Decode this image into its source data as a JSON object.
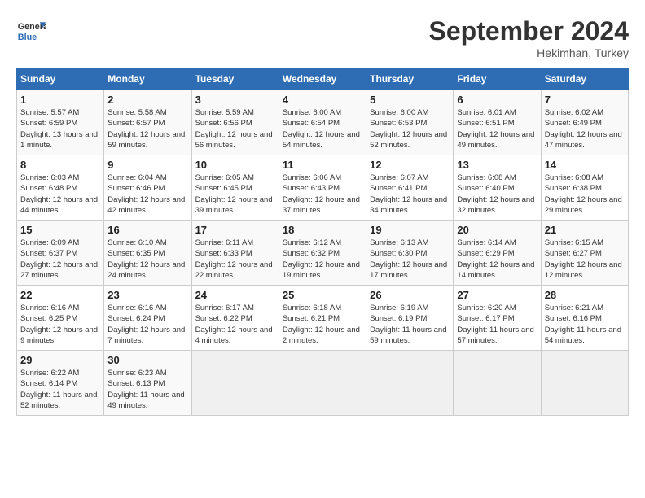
{
  "header": {
    "logo_line1": "General",
    "logo_line2": "Blue",
    "month": "September 2024",
    "location": "Hekimhan, Turkey"
  },
  "weekdays": [
    "Sunday",
    "Monday",
    "Tuesday",
    "Wednesday",
    "Thursday",
    "Friday",
    "Saturday"
  ],
  "weeks": [
    [
      {
        "day": "1",
        "info": "Sunrise: 5:57 AM\nSunset: 6:59 PM\nDaylight: 13 hours\nand 1 minute."
      },
      {
        "day": "2",
        "info": "Sunrise: 5:58 AM\nSunset: 6:57 PM\nDaylight: 12 hours\nand 59 minutes."
      },
      {
        "day": "3",
        "info": "Sunrise: 5:59 AM\nSunset: 6:56 PM\nDaylight: 12 hours\nand 56 minutes."
      },
      {
        "day": "4",
        "info": "Sunrise: 6:00 AM\nSunset: 6:54 PM\nDaylight: 12 hours\nand 54 minutes."
      },
      {
        "day": "5",
        "info": "Sunrise: 6:00 AM\nSunset: 6:53 PM\nDaylight: 12 hours\nand 52 minutes."
      },
      {
        "day": "6",
        "info": "Sunrise: 6:01 AM\nSunset: 6:51 PM\nDaylight: 12 hours\nand 49 minutes."
      },
      {
        "day": "7",
        "info": "Sunrise: 6:02 AM\nSunset: 6:49 PM\nDaylight: 12 hours\nand 47 minutes."
      }
    ],
    [
      {
        "day": "8",
        "info": "Sunrise: 6:03 AM\nSunset: 6:48 PM\nDaylight: 12 hours\nand 44 minutes."
      },
      {
        "day": "9",
        "info": "Sunrise: 6:04 AM\nSunset: 6:46 PM\nDaylight: 12 hours\nand 42 minutes."
      },
      {
        "day": "10",
        "info": "Sunrise: 6:05 AM\nSunset: 6:45 PM\nDaylight: 12 hours\nand 39 minutes."
      },
      {
        "day": "11",
        "info": "Sunrise: 6:06 AM\nSunset: 6:43 PM\nDaylight: 12 hours\nand 37 minutes."
      },
      {
        "day": "12",
        "info": "Sunrise: 6:07 AM\nSunset: 6:41 PM\nDaylight: 12 hours\nand 34 minutes."
      },
      {
        "day": "13",
        "info": "Sunrise: 6:08 AM\nSunset: 6:40 PM\nDaylight: 12 hours\nand 32 minutes."
      },
      {
        "day": "14",
        "info": "Sunrise: 6:08 AM\nSunset: 6:38 PM\nDaylight: 12 hours\nand 29 minutes."
      }
    ],
    [
      {
        "day": "15",
        "info": "Sunrise: 6:09 AM\nSunset: 6:37 PM\nDaylight: 12 hours\nand 27 minutes."
      },
      {
        "day": "16",
        "info": "Sunrise: 6:10 AM\nSunset: 6:35 PM\nDaylight: 12 hours\nand 24 minutes."
      },
      {
        "day": "17",
        "info": "Sunrise: 6:11 AM\nSunset: 6:33 PM\nDaylight: 12 hours\nand 22 minutes."
      },
      {
        "day": "18",
        "info": "Sunrise: 6:12 AM\nSunset: 6:32 PM\nDaylight: 12 hours\nand 19 minutes."
      },
      {
        "day": "19",
        "info": "Sunrise: 6:13 AM\nSunset: 6:30 PM\nDaylight: 12 hours\nand 17 minutes."
      },
      {
        "day": "20",
        "info": "Sunrise: 6:14 AM\nSunset: 6:29 PM\nDaylight: 12 hours\nand 14 minutes."
      },
      {
        "day": "21",
        "info": "Sunrise: 6:15 AM\nSunset: 6:27 PM\nDaylight: 12 hours\nand 12 minutes."
      }
    ],
    [
      {
        "day": "22",
        "info": "Sunrise: 6:16 AM\nSunset: 6:25 PM\nDaylight: 12 hours\nand 9 minutes."
      },
      {
        "day": "23",
        "info": "Sunrise: 6:16 AM\nSunset: 6:24 PM\nDaylight: 12 hours\nand 7 minutes."
      },
      {
        "day": "24",
        "info": "Sunrise: 6:17 AM\nSunset: 6:22 PM\nDaylight: 12 hours\nand 4 minutes."
      },
      {
        "day": "25",
        "info": "Sunrise: 6:18 AM\nSunset: 6:21 PM\nDaylight: 12 hours\nand 2 minutes."
      },
      {
        "day": "26",
        "info": "Sunrise: 6:19 AM\nSunset: 6:19 PM\nDaylight: 11 hours\nand 59 minutes."
      },
      {
        "day": "27",
        "info": "Sunrise: 6:20 AM\nSunset: 6:17 PM\nDaylight: 11 hours\nand 57 minutes."
      },
      {
        "day": "28",
        "info": "Sunrise: 6:21 AM\nSunset: 6:16 PM\nDaylight: 11 hours\nand 54 minutes."
      }
    ],
    [
      {
        "day": "29",
        "info": "Sunrise: 6:22 AM\nSunset: 6:14 PM\nDaylight: 11 hours\nand 52 minutes."
      },
      {
        "day": "30",
        "info": "Sunrise: 6:23 AM\nSunset: 6:13 PM\nDaylight: 11 hours\nand 49 minutes."
      },
      null,
      null,
      null,
      null,
      null
    ]
  ]
}
